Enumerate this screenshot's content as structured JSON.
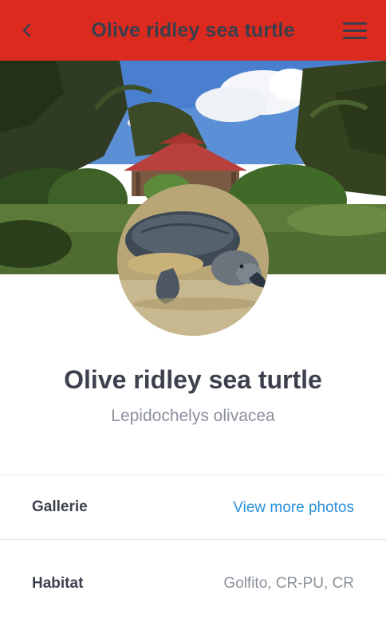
{
  "appbar": {
    "title": "Olive ridley sea turtle",
    "back_icon": "chevron-left-icon",
    "menu_icon": "hamburger-menu-icon",
    "color": "#dd2a1f"
  },
  "species": {
    "common_name": "Olive ridley sea turtle",
    "scientific_name": "Lepidochelys olivacea"
  },
  "details": {
    "gallery_label": "Gallerie",
    "gallery_link": "View more photos",
    "habitat_label": "Habitat",
    "habitat_value": "Golfito, CR-PU, CR"
  },
  "colors": {
    "accent": "#dd2a1f",
    "link": "#2a8fd8",
    "text_dark": "#3d414d",
    "text_muted": "#8b909c"
  }
}
